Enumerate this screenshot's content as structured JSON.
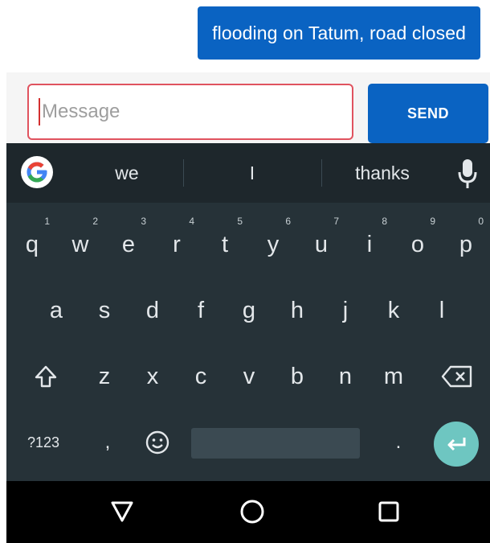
{
  "chat": {
    "message": "flooding on Tatum, road closed"
  },
  "compose": {
    "placeholder": "Message",
    "send_label": "SEND"
  },
  "keyboard": {
    "suggestions": [
      "we",
      "I",
      "thanks"
    ],
    "rows": {
      "row1": [
        {
          "key": "q",
          "hint": "1"
        },
        {
          "key": "w",
          "hint": "2"
        },
        {
          "key": "e",
          "hint": "3"
        },
        {
          "key": "r",
          "hint": "4"
        },
        {
          "key": "t",
          "hint": "5"
        },
        {
          "key": "y",
          "hint": "6"
        },
        {
          "key": "u",
          "hint": "7"
        },
        {
          "key": "i",
          "hint": "8"
        },
        {
          "key": "o",
          "hint": "9"
        },
        {
          "key": "p",
          "hint": "0"
        }
      ],
      "row2": [
        "a",
        "s",
        "d",
        "f",
        "g",
        "h",
        "j",
        "k",
        "l"
      ],
      "row3": [
        "z",
        "x",
        "c",
        "v",
        "b",
        "n",
        "m"
      ]
    },
    "symbols_label": "?123",
    "comma": ",",
    "period": "."
  },
  "icons": {
    "google": "google-g-logo",
    "mic": "microphone-icon",
    "shift": "shift-icon",
    "backspace": "backspace-icon",
    "emoji": "emoji-icon",
    "enter": "enter-icon",
    "back": "back-triangle-icon",
    "home": "home-circle-icon",
    "recents": "recents-square-icon"
  },
  "colors": {
    "accent": "#0a63c2",
    "keyboard_bg": "#263238",
    "enter_bg": "#6ec6c1",
    "input_border": "#e0535f"
  }
}
